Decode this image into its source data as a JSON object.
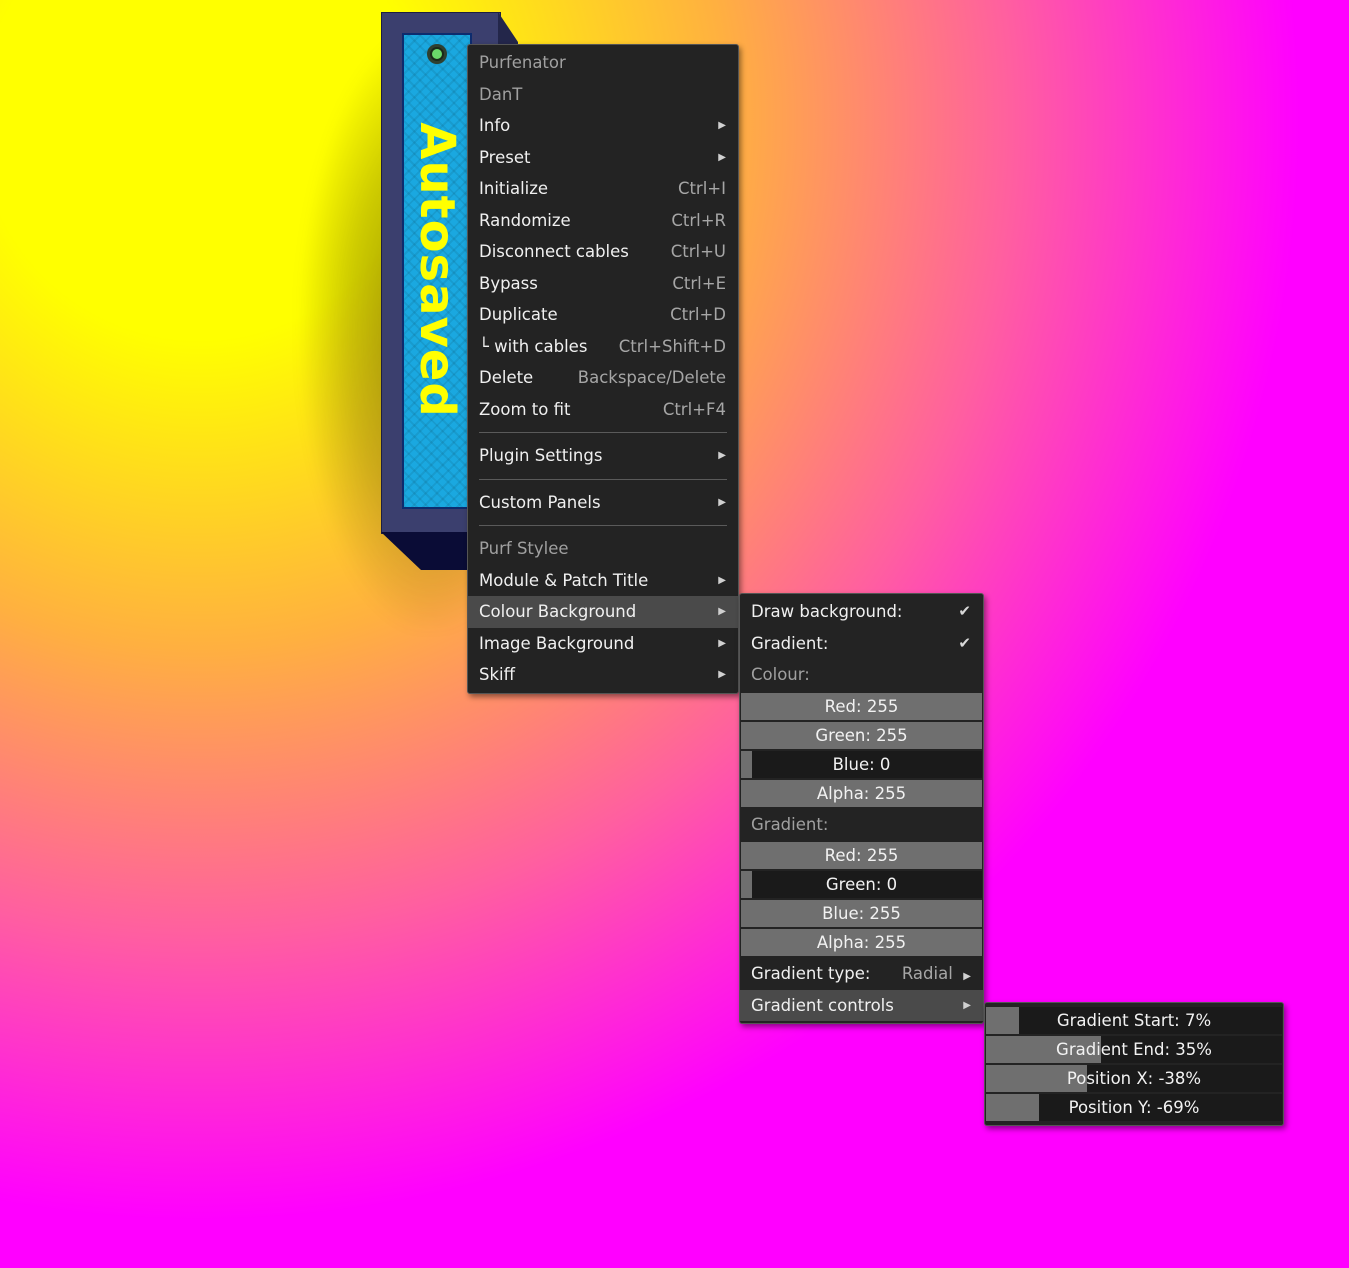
{
  "module": {
    "label": "Autosaved",
    "colors": {
      "panel": "#1aa8e0",
      "frame": "#3b3f6e",
      "label": "#ffff00"
    }
  },
  "context_menu": {
    "header_title": "Purfenator",
    "header_author": "DanT",
    "items": [
      {
        "label": "Info",
        "submenu": true
      },
      {
        "label": "Preset",
        "submenu": true
      },
      {
        "label": "Initialize",
        "shortcut": "Ctrl+I"
      },
      {
        "label": "Randomize",
        "shortcut": "Ctrl+R"
      },
      {
        "label": "Disconnect cables",
        "shortcut": "Ctrl+U"
      },
      {
        "label": "Bypass",
        "shortcut": "Ctrl+E"
      },
      {
        "label": "Duplicate",
        "shortcut": "Ctrl+D"
      },
      {
        "label": "└ with cables",
        "shortcut": "Ctrl+Shift+D"
      },
      {
        "label": "Delete",
        "shortcut": "Backspace/Delete"
      },
      {
        "label": "Zoom to fit",
        "shortcut": "Ctrl+F4"
      }
    ],
    "plugin_settings": "Plugin Settings",
    "custom_panels": "Custom Panels",
    "section_title": "Purf Stylee",
    "style_items": [
      {
        "label": "Module & Patch Title",
        "submenu": true
      },
      {
        "label": "Colour Background",
        "submenu": true,
        "highlighted": true
      },
      {
        "label": "Image Background",
        "submenu": true
      },
      {
        "label": "Skiff",
        "submenu": true
      }
    ]
  },
  "colour_menu": {
    "draw_background": "Draw background:",
    "draw_background_checked": true,
    "gradient_toggle": "Gradient:",
    "gradient_checked": true,
    "colour_heading": "Colour:",
    "colour_sliders": [
      {
        "label": "Red: 255",
        "value": 1.0
      },
      {
        "label": "Green: 255",
        "value": 1.0
      },
      {
        "label": "Blue: 0",
        "value": 0.0
      },
      {
        "label": "Alpha: 255",
        "value": 1.0
      }
    ],
    "gradient_heading": "Gradient:",
    "gradient_sliders": [
      {
        "label": "Red: 255",
        "value": 1.0
      },
      {
        "label": "Green: 0",
        "value": 0.0
      },
      {
        "label": "Blue: 255",
        "value": 1.0
      },
      {
        "label": "Alpha: 255",
        "value": 1.0
      }
    ],
    "gradient_type_label": "Gradient type:",
    "gradient_type_value": "Radial",
    "gradient_controls": "Gradient controls"
  },
  "gradient_controls_menu": {
    "sliders": [
      {
        "label": "Gradient Start: 7%",
        "value": 0.11
      },
      {
        "label": "Gradient End: 35%",
        "value": 0.39
      },
      {
        "label": "Position X: -38%",
        "value": 0.34
      },
      {
        "label": "Position Y: -69%",
        "value": 0.18
      }
    ]
  },
  "icons": {
    "submenu": "arrow-right-icon",
    "check": "checkmark-icon",
    "check_glyph": "✔",
    "arrow_glyph": "▶"
  }
}
